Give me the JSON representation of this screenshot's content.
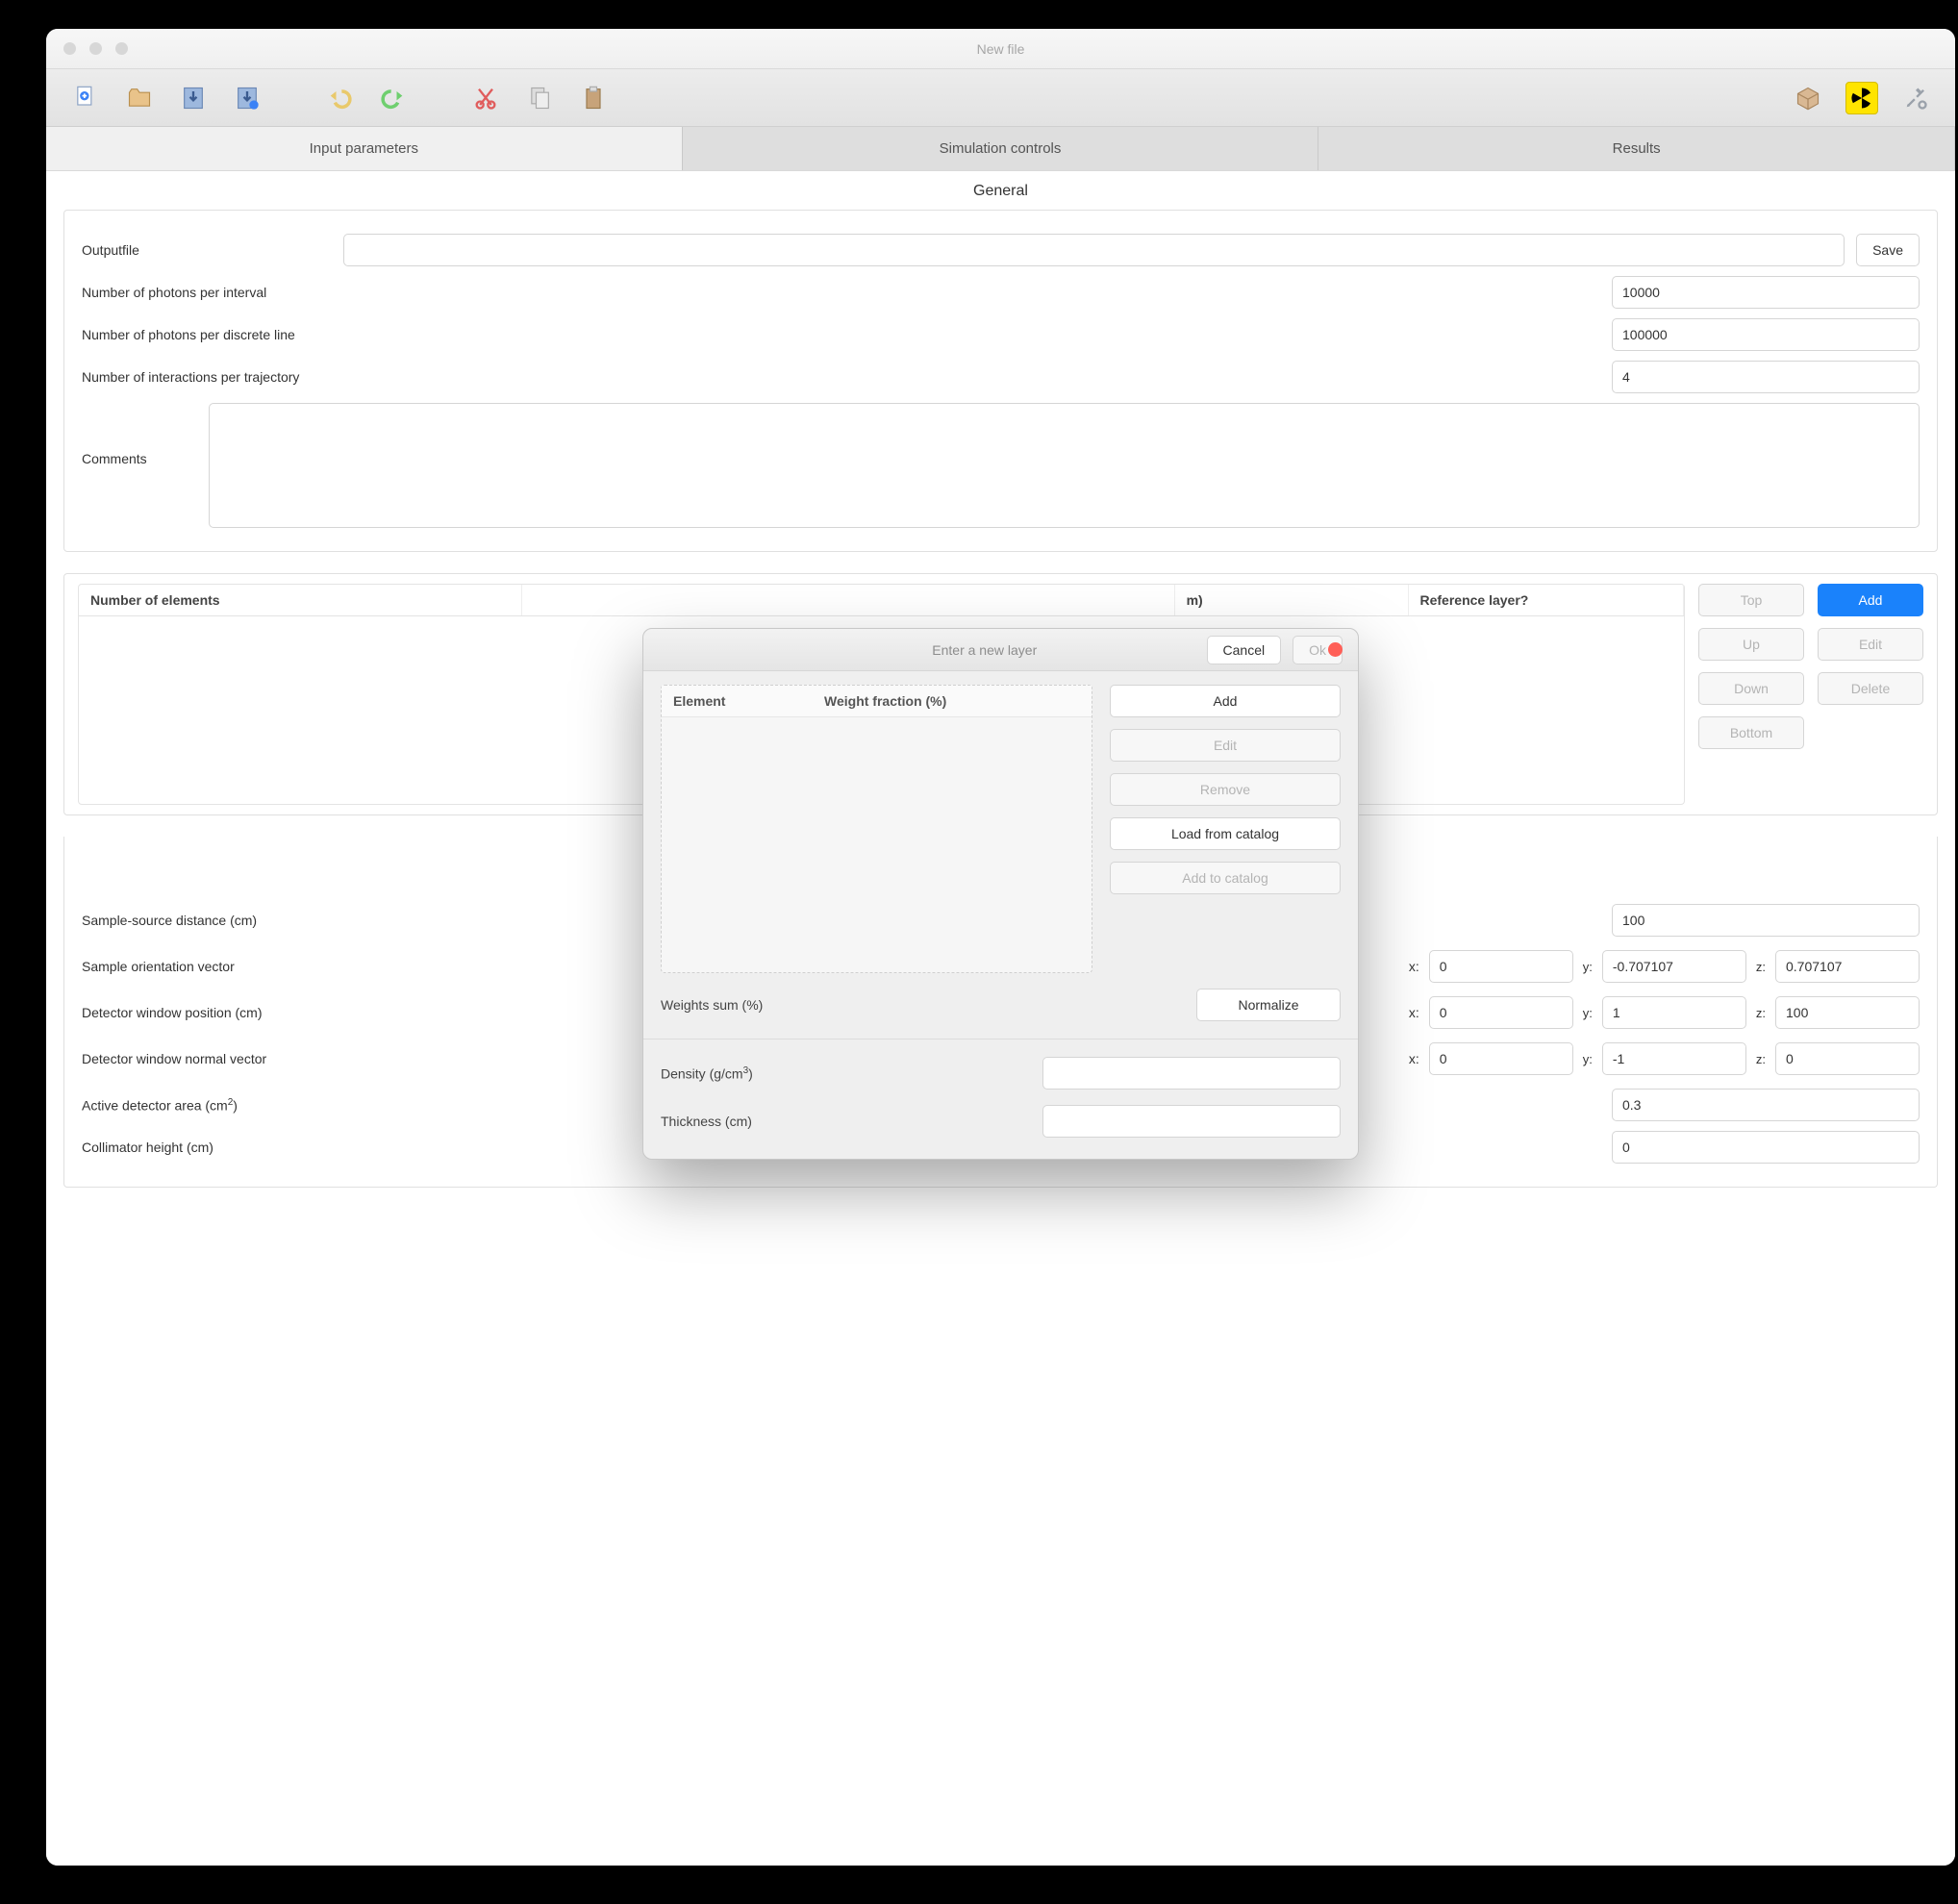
{
  "window": {
    "title": "New file"
  },
  "toolbar_icons": {
    "new": "new-file-icon",
    "open": "open-folder-icon",
    "save": "save-icon",
    "save_as": "save-as-icon",
    "undo": "undo-icon",
    "redo": "redo-icon",
    "cut": "cut-icon",
    "copy": "copy-icon",
    "paste": "paste-icon",
    "pack": "package-icon",
    "radiation": "radiation-icon",
    "prefs": "preferences-icon"
  },
  "tabs": {
    "input": "Input parameters",
    "sim": "Simulation controls",
    "results": "Results",
    "active": "input"
  },
  "general": {
    "section_title": "General",
    "outputfile_label": "Outputfile",
    "outputfile_value": "",
    "save_label": "Save",
    "photons_interval_label": "Number of photons per interval",
    "photons_interval_value": "10000",
    "photons_line_label": "Number of photons per discrete line",
    "photons_line_value": "100000",
    "interactions_label": "Number of interactions per trajectory",
    "interactions_value": "4",
    "comments_label": "Comments",
    "comments_value": ""
  },
  "composition": {
    "headers": {
      "num_elements": "Number of elements",
      "density_thickness": "m)",
      "reference": "Reference layer?"
    },
    "buttons": {
      "top": "Top",
      "up": "Up",
      "down": "Down",
      "bottom": "Bottom",
      "add": "Add",
      "edit": "Edit",
      "delete": "Delete"
    }
  },
  "geometry": {
    "sample_source_label": "Sample-source distance (cm)",
    "sample_source_value": "100",
    "orientation_label": "Sample orientation vector",
    "orientation": {
      "x": "0",
      "y": "-0.707107",
      "z": "0.707107"
    },
    "det_window_pos_label": "Detector window position (cm)",
    "det_window_pos": {
      "x": "0",
      "y": "1",
      "z": "100"
    },
    "det_window_normal_label": "Detector window normal vector",
    "det_window_normal": {
      "x": "0",
      "y": "-1",
      "z": "0"
    },
    "active_area_label_prefix": "Active detector area (cm",
    "active_area_label_suffix": ")",
    "active_area_value": "0.3",
    "collimator_height_label": "Collimator height (cm)",
    "collimator_height_value": "0",
    "axis_labels": {
      "x": "x:",
      "y": "y:",
      "z": "z:"
    }
  },
  "dialog": {
    "title": "Enter a new layer",
    "cancel": "Cancel",
    "ok": "Ok",
    "element_header": "Element",
    "weight_header": "Weight fraction (%)",
    "buttons": {
      "add": "Add",
      "edit": "Edit",
      "remove": "Remove",
      "load": "Load from catalog",
      "add_catalog": "Add to catalog",
      "normalize": "Normalize"
    },
    "weights_sum_label": "Weights sum (%)",
    "weights_sum_value": "",
    "density_label_prefix": "Density (g/cm",
    "density_label_suffix": ")",
    "density_value": "",
    "thickness_label": "Thickness (cm)",
    "thickness_value": ""
  }
}
